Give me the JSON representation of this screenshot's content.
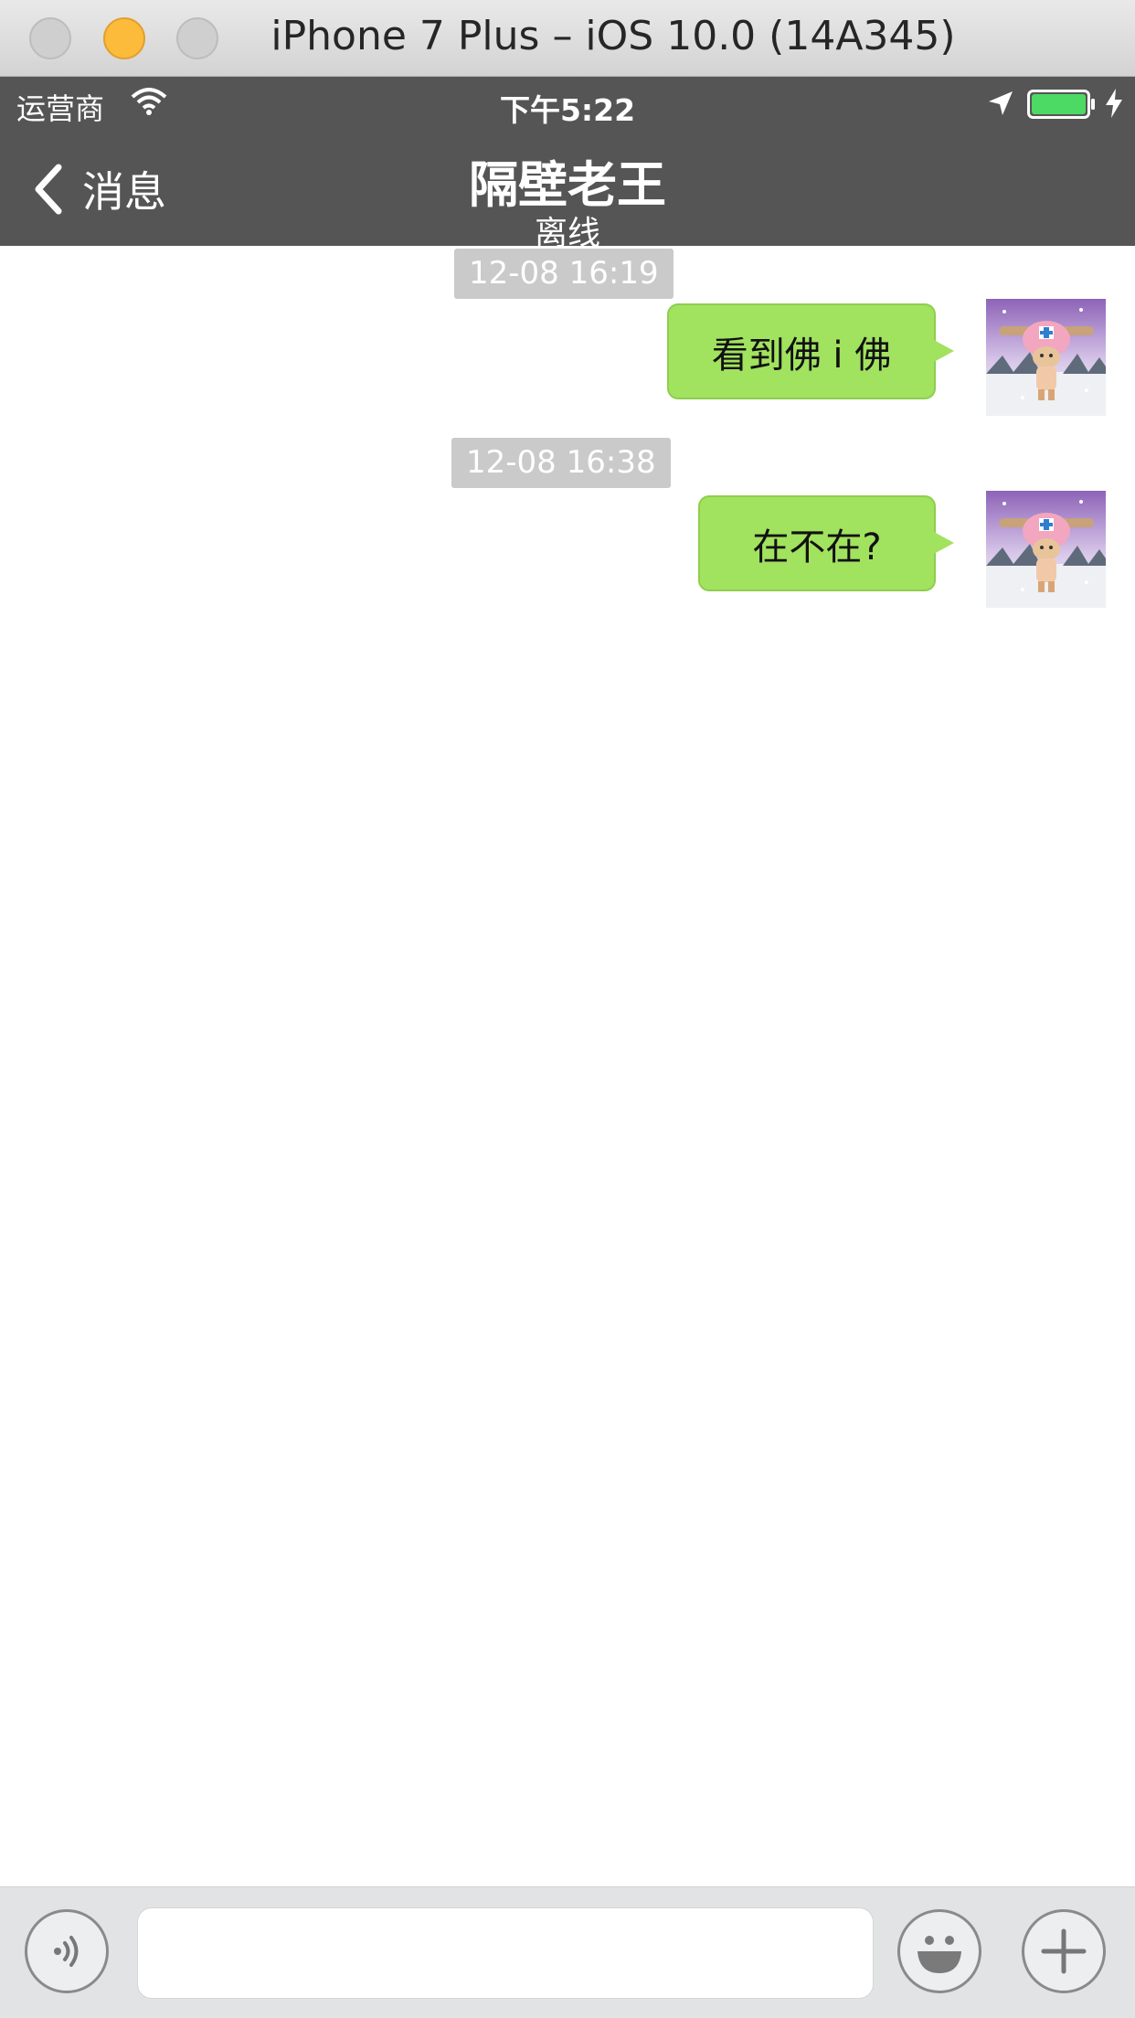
{
  "window": {
    "title": "iPhone 7 Plus – iOS 10.0 (14A345)"
  },
  "status_bar": {
    "carrier": "运营商",
    "time": "下午5:22",
    "battery_color": "#4cd964"
  },
  "nav": {
    "back_label": "消息",
    "title": "隔壁老王",
    "subtitle": "离线"
  },
  "messages": [
    {
      "timestamp": "12-08 16:19",
      "text": "看到佛 i 佛",
      "sender": "self"
    },
    {
      "timestamp": "12-08 16:38",
      "text": "在不在?",
      "sender": "self"
    }
  ],
  "input": {
    "value": "",
    "placeholder": ""
  },
  "colors": {
    "bar_background": "#555555",
    "bubble_green": "#a1e25f",
    "timestamp_pill": "#cacaca"
  },
  "icons": [
    "wifi-icon",
    "location-arrow-icon",
    "battery-icon",
    "charging-bolt-icon",
    "chevron-left-icon",
    "voice-icon",
    "emoji-icon",
    "plus-icon"
  ]
}
